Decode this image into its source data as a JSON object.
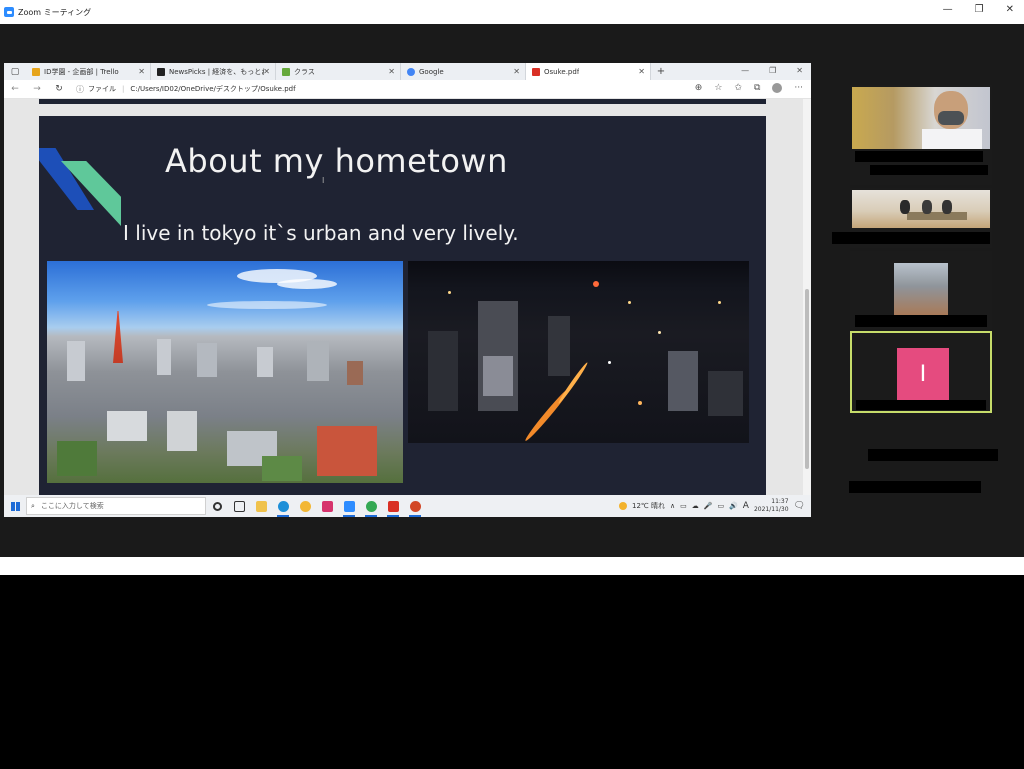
{
  "zoom": {
    "title": "Zoom ミーティング",
    "controls": [
      "—",
      "❐",
      "✕"
    ]
  },
  "browser": {
    "tabs": [
      {
        "label": "ID学園 - 企画部 | Trello",
        "color": "#e6a41b",
        "active": false
      },
      {
        "label": "NewsPicks | 経済を、もっとおもしろく",
        "color": "#222222",
        "active": false
      },
      {
        "label": "クラス",
        "color": "#67a93c",
        "active": false
      },
      {
        "label": "Google",
        "color": "#4285f4",
        "active": false
      },
      {
        "label": "Osuke.pdf",
        "color": "#d93025",
        "active": true
      }
    ],
    "new_tab": "+",
    "window_controls": [
      "—",
      "❐",
      "✕"
    ],
    "address": {
      "scheme_label": "ファイル",
      "path": "C:/Users/ID02/OneDrive/デスクトップ/Osuke.pdf"
    }
  },
  "slide": {
    "title": "About my hometown",
    "body": "I live in tokyo it`s urban and very lively.",
    "cursor": "I"
  },
  "taskbar": {
    "search_placeholder": "ここに入力して検索",
    "weather": "12℃  晴れ",
    "ime": "A",
    "time": "11:37",
    "date": "2021/11/30"
  }
}
